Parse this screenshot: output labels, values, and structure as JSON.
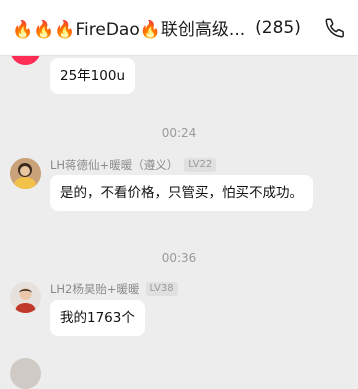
{
  "header": {
    "title": "🔥🔥🔥FireDao🔥联创高级...",
    "member_count": "(285)",
    "phone_icon": "phone-icon"
  },
  "messages": [
    {
      "text": "25年100u"
    },
    {
      "time": "00:24"
    },
    {
      "sender": "LH蒋德仙+暖暖（遵义）",
      "level": "LV22",
      "text": "是的，不看价格，只管买，怕买不成功。"
    },
    {
      "time": "00:36"
    },
    {
      "sender": "LH2杨昊贻+暖暖",
      "level": "LV38",
      "text": "我的1763个"
    }
  ],
  "colors": {
    "bubble": "#ffffff",
    "background": "#ededed",
    "avatar_top": "#ff2d55"
  }
}
